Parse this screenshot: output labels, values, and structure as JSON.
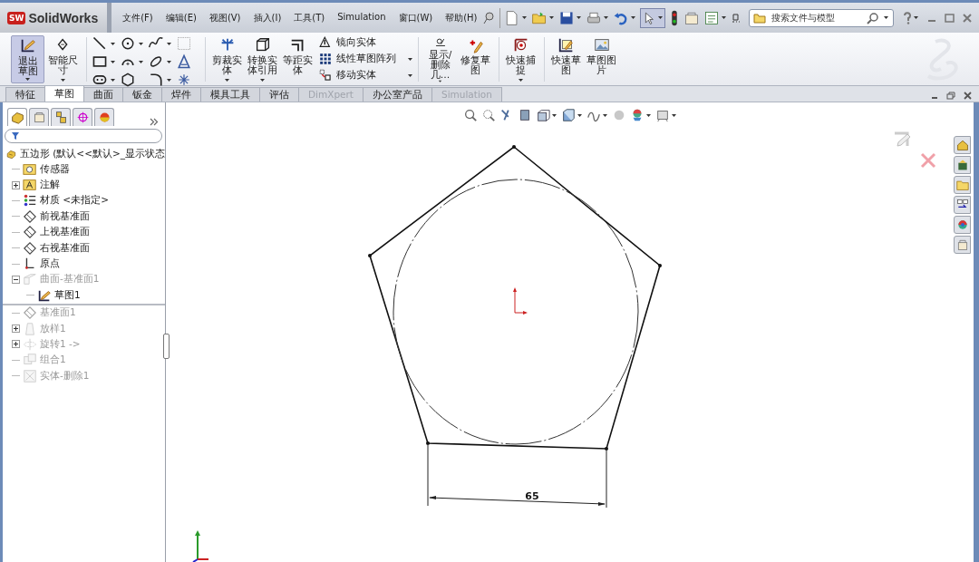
{
  "app": {
    "badge": "SW",
    "name": "SolidWorks"
  },
  "menus": [
    "文件(F)",
    "编辑(E)",
    "视图(V)",
    "插入(I)",
    "工具(T)",
    "Simulation",
    "窗口(W)",
    "帮助(H)"
  ],
  "search": {
    "placeholder": "搜索文件与模型"
  },
  "ribbon": [
    {
      "kind": "large",
      "label": "退出草图",
      "pressed": true,
      "dropdown": true
    },
    {
      "kind": "large",
      "label": "智能尺寸",
      "pressed": false,
      "dropdown": true
    },
    {
      "kind": "separator"
    },
    {
      "kind": "sketch-tools"
    },
    {
      "kind": "separator"
    },
    {
      "kind": "large",
      "label": "剪裁实体",
      "pressed": false,
      "dropdown": true
    },
    {
      "kind": "large",
      "label": "转换实体引用",
      "pressed": false,
      "dropdown": true
    },
    {
      "kind": "large",
      "label": "等距实体",
      "pressed": false,
      "dropdown": false
    },
    {
      "kind": "list",
      "items": [
        {
          "label": "镜向实体",
          "dropdown": false
        },
        {
          "label": "线性草图阵列",
          "dropdown": true
        },
        {
          "label": "移动实体",
          "dropdown": true
        }
      ]
    },
    {
      "kind": "separator"
    },
    {
      "kind": "large",
      "label": "显示/删除几…",
      "pressed": false,
      "dropdown": true
    },
    {
      "kind": "large",
      "label": "修复草图",
      "pressed": false,
      "dropdown": false
    },
    {
      "kind": "separator"
    },
    {
      "kind": "large",
      "label": "快速捕捉",
      "pressed": false,
      "dropdown": true
    },
    {
      "kind": "separator"
    },
    {
      "kind": "large",
      "label": "快速草图",
      "pressed": false,
      "dropdown": false
    },
    {
      "kind": "large",
      "label": "草图图片",
      "pressed": false,
      "dropdown": false
    }
  ],
  "tabs": [
    {
      "label": "特征",
      "selected": false,
      "disabled": false
    },
    {
      "label": "草图",
      "selected": true,
      "disabled": false
    },
    {
      "label": "曲面",
      "selected": false,
      "disabled": false
    },
    {
      "label": "钣金",
      "selected": false,
      "disabled": false
    },
    {
      "label": "焊件",
      "selected": false,
      "disabled": false
    },
    {
      "label": "模具工具",
      "selected": false,
      "disabled": false
    },
    {
      "label": "评估",
      "selected": false,
      "disabled": false
    },
    {
      "label": "DimXpert",
      "selected": false,
      "disabled": true
    },
    {
      "label": "办公室产品",
      "selected": false,
      "disabled": false
    },
    {
      "label": "Simulation",
      "selected": false,
      "disabled": true
    }
  ],
  "panel_tabs": [
    {
      "selected": true
    },
    {
      "selected": false
    },
    {
      "selected": false
    },
    {
      "selected": false
    },
    {
      "selected": false
    }
  ],
  "feature_tree": {
    "root": {
      "label": "五边形  (默认<<默认>_显示状态",
      "children": [
        {
          "kind": "sensor",
          "label": "传感器",
          "dimmed": false
        },
        {
          "kind": "annotation",
          "label": "注解",
          "dimmed": false,
          "expanded": false
        },
        {
          "kind": "material",
          "label": "材质 <未指定>",
          "dimmed": false
        },
        {
          "kind": "plane",
          "label": "前视基准面",
          "dimmed": false
        },
        {
          "kind": "plane",
          "label": "上视基准面",
          "dimmed": false
        },
        {
          "kind": "plane",
          "label": "右视基准面",
          "dimmed": false
        },
        {
          "kind": "origin",
          "label": "原点",
          "dimmed": false
        },
        {
          "kind": "surface",
          "label": "曲面-基准面1",
          "dimmed": true,
          "expanded": true,
          "children": [
            {
              "kind": "sketch",
              "label": "草图1",
              "dimmed": false
            }
          ]
        },
        {
          "kind": "rollback"
        },
        {
          "kind": "plane",
          "label": "基准面1",
          "dimmed": true
        },
        {
          "kind": "loft",
          "label": "放样1",
          "dimmed": true,
          "expanded": false
        },
        {
          "kind": "revolve",
          "label": "旋转1 ->",
          "dimmed": true,
          "expanded": false
        },
        {
          "kind": "combine",
          "label": "组合1",
          "dimmed": true
        },
        {
          "kind": "delete-body",
          "label": "实体-删除1",
          "dimmed": true
        }
      ]
    }
  },
  "sketch": {
    "dimension": "65"
  }
}
